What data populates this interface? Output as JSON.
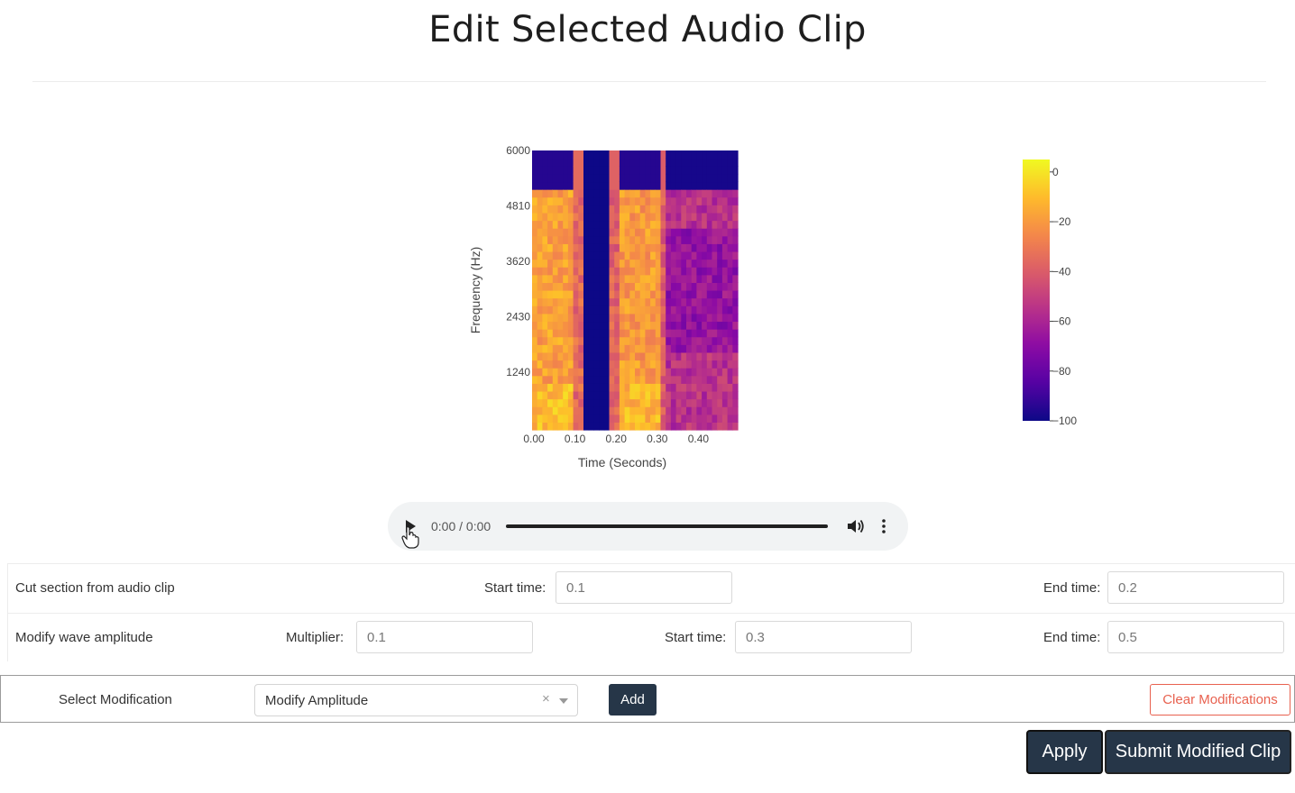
{
  "page": {
    "title": "Edit Selected Audio Clip"
  },
  "chart_data": {
    "type": "heatmap",
    "xlabel": "Time (Seconds)",
    "ylabel": "Frequency (Hz)",
    "xticks": [
      "0.00",
      "0.10",
      "0.20",
      "0.30",
      "0.40"
    ],
    "yticks": [
      "1240",
      "2430",
      "3620",
      "4810",
      "6000"
    ],
    "xlim": [
      0,
      0.5
    ],
    "ylim": [
      0,
      6000
    ],
    "colorscale": "plasma",
    "zlim": [
      -100,
      5
    ],
    "colorbar_ticks": [
      "0",
      "−20",
      "−40",
      "−60",
      "−80",
      "−100"
    ],
    "time_segments": [
      {
        "start": 0.0,
        "end": 0.095,
        "level": -18,
        "top_fill": -95
      },
      {
        "start": 0.095,
        "end": 0.12,
        "level": -35,
        "top_fill": -35
      },
      {
        "start": 0.12,
        "end": 0.19,
        "level": -100,
        "top_fill": -100
      },
      {
        "start": 0.19,
        "end": 0.215,
        "level": -38,
        "top_fill": -38
      },
      {
        "start": 0.215,
        "end": 0.31,
        "level": -20,
        "top_fill": -95
      },
      {
        "start": 0.31,
        "end": 0.33,
        "level": -40,
        "top_fill": -40
      },
      {
        "start": 0.33,
        "end": 0.5,
        "level": -55,
        "top_fill": -98
      }
    ]
  },
  "player": {
    "time": "0:00 / 0:00"
  },
  "modifications": {
    "cut": {
      "label": "Cut section from audio clip",
      "start_label": "Start time:",
      "start_value": "0.1",
      "end_label": "End time:",
      "end_value": "0.2"
    },
    "amplitude": {
      "label": "Modify wave amplitude",
      "multiplier_label": "Multiplier:",
      "multiplier_value": "0.1",
      "start_label": "Start time:",
      "start_value": "0.3",
      "end_label": "End time:",
      "end_value": "0.5"
    }
  },
  "selector": {
    "label": "Select Modification",
    "selected": "Modify Amplitude",
    "clear_symbol": "×",
    "add_label": "Add",
    "clear_label": "Clear Modifications"
  },
  "actions": {
    "apply_label": "Apply",
    "submit_label": "Submit Modified Clip"
  },
  "colors": {
    "primary_button": "#263648",
    "danger": "#e8614f",
    "player_bg": "#f1f3f4"
  }
}
